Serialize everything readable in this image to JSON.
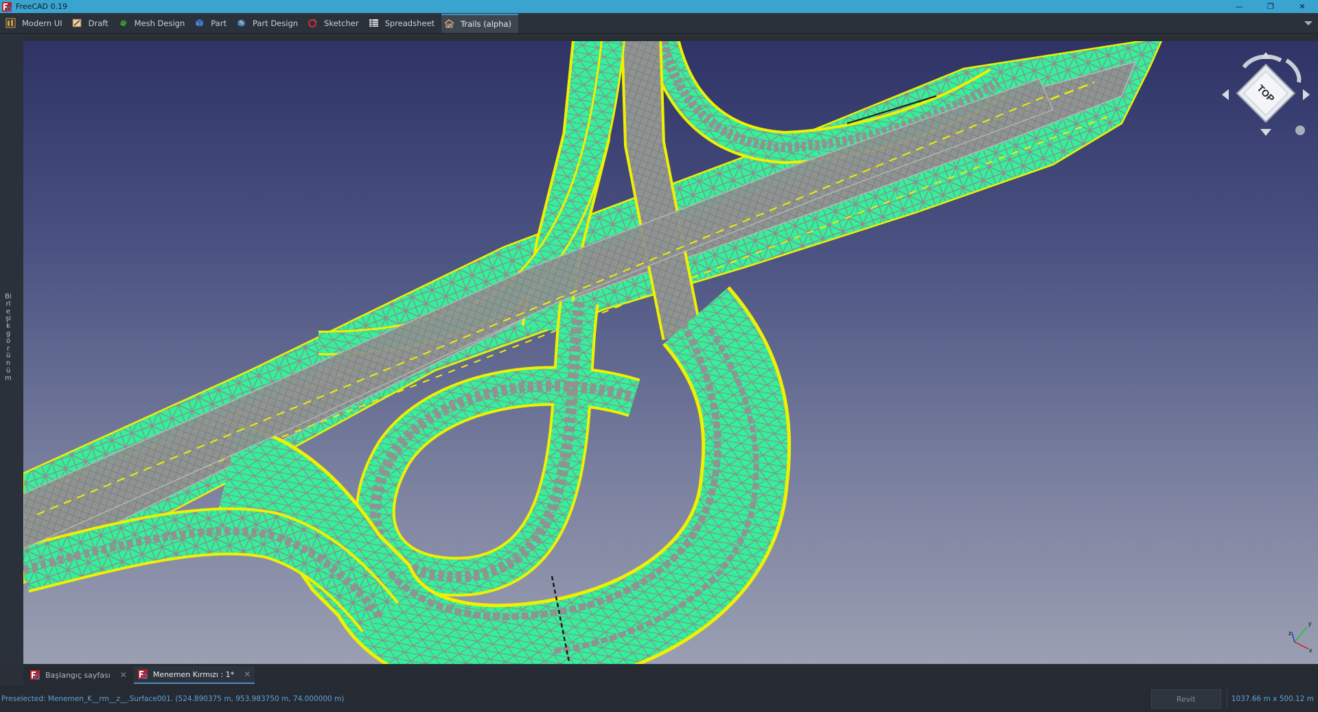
{
  "window": {
    "title": "FreeCAD 0.19",
    "minimize": "—",
    "restore": "❐",
    "close": "✕"
  },
  "workbenches": [
    {
      "label": "Modern UI",
      "icon": "modern-ui-icon",
      "color": "#c8a060"
    },
    {
      "label": "Draft",
      "icon": "draft-icon",
      "color": "#d0a060"
    },
    {
      "label": "Mesh Design",
      "icon": "mesh-design-icon",
      "color": "#5ab04a"
    },
    {
      "label": "Part",
      "icon": "part-icon",
      "color": "#4a86d0"
    },
    {
      "label": "Part Design",
      "icon": "part-design-icon",
      "color": "#4a86d0"
    },
    {
      "label": "Sketcher",
      "icon": "sketcher-icon",
      "color": "#d03030"
    },
    {
      "label": "Spreadsheet",
      "icon": "spreadsheet-icon",
      "color": "#e0e0e0"
    },
    {
      "label": "Trails (alpha)",
      "icon": "trails-icon",
      "color": "#c8b08a",
      "active": true
    }
  ],
  "left_panel": {
    "label": "Birleşik görünüm"
  },
  "nav_cube": {
    "face": "TOP"
  },
  "doc_tabs": [
    {
      "label": "Başlangıç sayfası",
      "active": false
    },
    {
      "label": "Menemen Kırmızı : 1*",
      "active": true
    }
  ],
  "status": {
    "preselected": "Preselected: Menemen_K__rm__z__.Surface001. (524.890375 m, 953.983750 m, 74.000000 m)",
    "nav_style": "Revit",
    "dimensions": "1037.66 m x 500.12 m"
  },
  "colors": {
    "mesh_fill": "#33f09a",
    "mesh_edge": "#8a8f8e",
    "breakline": "#f0f000",
    "accent": "#3aa4d0"
  }
}
